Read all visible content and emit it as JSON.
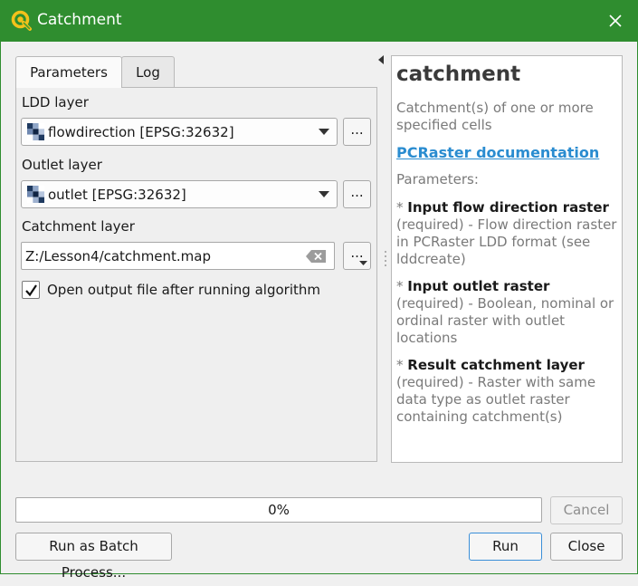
{
  "window": {
    "title": "Catchment",
    "icons": {
      "app": "qgis-logo-icon",
      "close": "close-icon"
    }
  },
  "tabs": [
    {
      "label": "Parameters",
      "active": true
    },
    {
      "label": "Log",
      "active": false
    }
  ],
  "params": {
    "ldd": {
      "label": "LDD layer",
      "value": "flowdirection [EPSG:32632]",
      "browse_label": "..."
    },
    "outlet": {
      "label": "Outlet layer",
      "value": "outlet [EPSG:32632]",
      "browse_label": "..."
    },
    "catchment": {
      "label": "Catchment layer",
      "value": "Z:/Lesson4/catchment.map",
      "browse_label": "..."
    },
    "open_output": {
      "label": "Open output file after running algorithm",
      "checked": true
    }
  },
  "help": {
    "title": "catchment",
    "description": "Catchment(s) of one or more specified cells",
    "link": "PCRaster documentation",
    "params_heading": "Parameters:",
    "items": [
      {
        "bullet": "* ",
        "name": "Input flow direction raster",
        "text": " (required) - Flow direction raster in PCRaster LDD format (see lddcreate)"
      },
      {
        "bullet": "* ",
        "name": "Input outlet raster",
        "text": " (required) - Boolean, nominal or ordinal raster with outlet locations"
      },
      {
        "bullet": "* ",
        "name": "Result catchment layer",
        "text": " (required) - Raster with same data type as outlet raster containing catchment(s)"
      }
    ]
  },
  "progress": {
    "text": "0%",
    "value": 0
  },
  "buttons": {
    "cancel": "Cancel",
    "batch": "Run as Batch Process...",
    "run": "Run",
    "close": "Close"
  },
  "colors": {
    "titlebar": "#2f8d2f",
    "link": "#2a8cd0"
  }
}
